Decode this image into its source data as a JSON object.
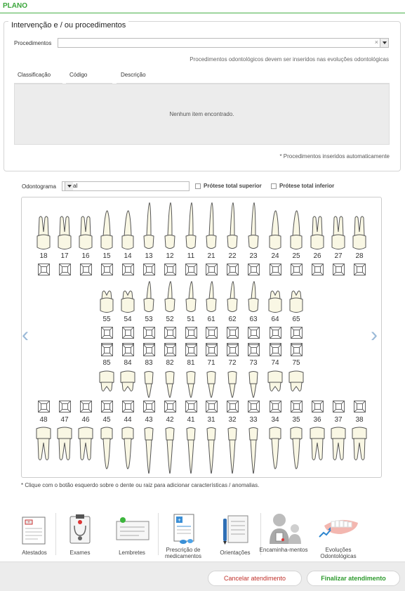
{
  "section": {
    "title": "PLANO"
  },
  "procedures": {
    "legend": "Intervenção e / ou procedimentos",
    "label": "Procedimentos",
    "value": "",
    "clear_glyph": "×",
    "note": "Procedimentos odontológicos devem ser inseridos nas evoluções odontológicas",
    "table": {
      "columns": [
        "Classificação",
        "Código",
        "Descrição"
      ],
      "empty_text": "Nenhum item encontrado."
    },
    "auto_note": "* Procedimentos inseridos automaticamente"
  },
  "odontogram": {
    "label": "Odontograma",
    "selected": "Atual",
    "checkbox_upper": "Prótese total superior",
    "checkbox_lower": "Prótese total inferior",
    "upper_permanent": [
      "18",
      "17",
      "16",
      "15",
      "14",
      "13",
      "12",
      "11",
      "21",
      "22",
      "23",
      "24",
      "25",
      "26",
      "27",
      "28"
    ],
    "upper_deciduous": [
      "55",
      "54",
      "53",
      "52",
      "51",
      "61",
      "62",
      "63",
      "64",
      "65"
    ],
    "lower_deciduous": [
      "85",
      "84",
      "83",
      "82",
      "81",
      "71",
      "72",
      "73",
      "74",
      "75"
    ],
    "lower_permanent": [
      "48",
      "47",
      "46",
      "45",
      "44",
      "43",
      "42",
      "41",
      "31",
      "32",
      "33",
      "34",
      "35",
      "36",
      "37",
      "38"
    ],
    "prev_arrow": "‹",
    "next_arrow": "›",
    "hint": "* Clique com o botão esquerdo sobre o dente ou raiz para adicionar características / anomalias."
  },
  "toolbar": {
    "items": [
      {
        "label": "Atestados",
        "icon": "certificate-icon"
      },
      {
        "label": "Exames",
        "icon": "clipboard-stethoscope-icon"
      },
      {
        "label": "Lembretes",
        "icon": "reminder-icon"
      },
      {
        "label": "Prescrição de medicamentos",
        "icon": "prescription-icon"
      },
      {
        "label": "Orientações",
        "icon": "guidelines-icon"
      },
      {
        "label": "Encaminha-mentos",
        "icon": "referral-icon"
      },
      {
        "label": "Evoluções Odontológicas",
        "icon": "dental-evolution-icon"
      }
    ]
  },
  "footer": {
    "cancel_label": "Cancelar atendimento",
    "finish_label": "Finalizar atendimento"
  },
  "colors": {
    "accent_green": "#3aa53a",
    "cancel_red": "#c0312b",
    "tooth_fill": "#f9f7e4",
    "arrow_blue": "#9bbad8"
  }
}
